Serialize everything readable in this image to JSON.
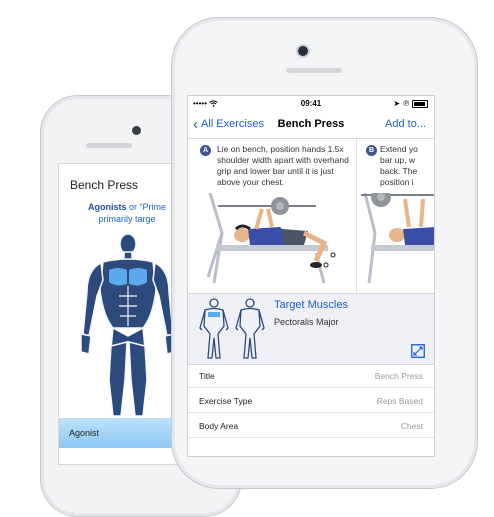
{
  "back_phone": {
    "title": "Bench Press",
    "caption_bold": "Agonists",
    "caption_rest": " or “Prime",
    "caption_line2": "primarily targe",
    "agonist_label": "Agonist"
  },
  "status_bar": {
    "signal": "•••••",
    "wifi_icon": "wifi-icon",
    "time": "09:41",
    "location_icon": "location-arrow-icon",
    "bluetooth_icon": "bluetooth-icon"
  },
  "nav": {
    "back_label": "All Exercises",
    "title": "Bench Press",
    "add_label": "Add to..."
  },
  "steps": [
    {
      "badge": "A",
      "text": "Lie on bench, position hands 1.5x shoulder width apart with overhand grip and lower bar until it is just above your chest."
    },
    {
      "badge": "B",
      "text_lines": [
        "Extend yo",
        "bar up, w",
        "back. The",
        "position i"
      ]
    }
  ],
  "muscles": {
    "title": "Target Muscles",
    "value": "Pectoralis Major"
  },
  "details": [
    {
      "label": "Title",
      "value": "Bench Press"
    },
    {
      "label": "Exercise Type",
      "value": "Reps Based"
    },
    {
      "label": "Body Area",
      "value": "Chest"
    }
  ],
  "colors": {
    "accent": "#1a5fd0",
    "figure": "#2c4a7c",
    "highlight": "#5aa9ea"
  }
}
